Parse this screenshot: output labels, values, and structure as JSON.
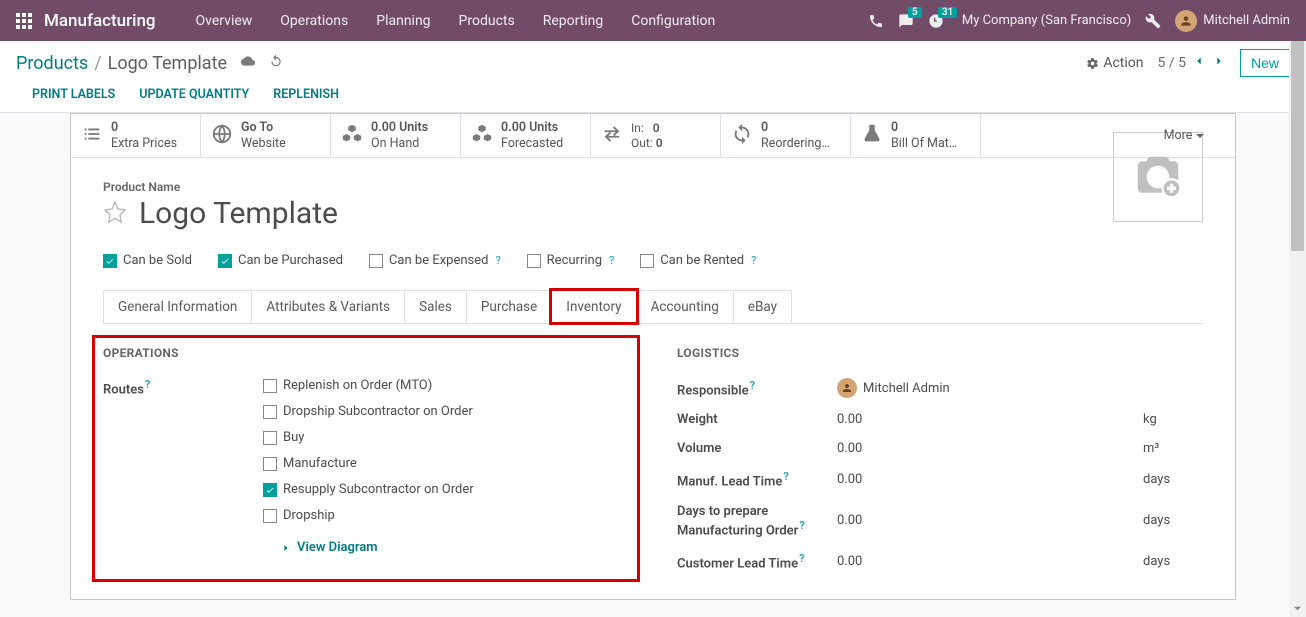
{
  "brand": "Manufacturing",
  "nav": [
    "Overview",
    "Operations",
    "Planning",
    "Products",
    "Reporting",
    "Configuration"
  ],
  "badges": {
    "chat": "5",
    "clock": "31"
  },
  "company": "My Company (San Francisco)",
  "user": "Mitchell Admin",
  "breadcrumb": {
    "root": "Products",
    "current": "Logo Template"
  },
  "action_menu": "Action",
  "pager": "5 / 5",
  "btn_new": "New",
  "action_links": [
    "PRINT LABELS",
    "UPDATE QUANTITY",
    "REPLENISH"
  ],
  "stats": {
    "extra": {
      "v": "0",
      "l": "Extra Prices"
    },
    "goto": {
      "v": "Go To",
      "l": "Website"
    },
    "onhand": {
      "v": "0.00 Units",
      "l": "On Hand"
    },
    "forec": {
      "v": "0.00 Units",
      "l": "Forecasted"
    },
    "inout": {
      "in_l": "In:",
      "in_v": "0",
      "out_l": "Out:",
      "out_v": "0"
    },
    "reord": {
      "v": "0",
      "l": "Reordering…"
    },
    "bom": {
      "v": "0",
      "l": "Bill Of Mat…"
    },
    "more": "More"
  },
  "prod": {
    "name_label": "Product Name",
    "name": "Logo Template"
  },
  "bools": {
    "sold": "Can be Sold",
    "purch": "Can be Purchased",
    "exp": "Can be Expensed",
    "recur": "Recurring",
    "rent": "Can be Rented"
  },
  "tabs": [
    "General Information",
    "Attributes & Variants",
    "Sales",
    "Purchase",
    "Inventory",
    "Accounting",
    "eBay"
  ],
  "ops": {
    "title": "OPERATIONS",
    "routes_label": "Routes",
    "routes": [
      {
        "label": "Replenish on Order (MTO)",
        "checked": false
      },
      {
        "label": "Dropship Subcontractor on Order",
        "checked": false
      },
      {
        "label": "Buy",
        "checked": false
      },
      {
        "label": "Manufacture",
        "checked": false
      },
      {
        "label": "Resupply Subcontractor on Order",
        "checked": true
      },
      {
        "label": "Dropship",
        "checked": false
      }
    ],
    "view_diag": "View Diagram"
  },
  "log": {
    "title": "LOGISTICS",
    "resp_l": "Responsible",
    "resp_v": "Mitchell Admin",
    "weight_l": "Weight",
    "weight_v": "0.00",
    "weight_u": "kg",
    "vol_l": "Volume",
    "vol_v": "0.00",
    "vol_u": "m³",
    "mlt_l": "Manuf. Lead Time",
    "mlt_v": "0.00",
    "mlt_u": "days",
    "dpm_l": "Days to prepare Manufacturing Order",
    "dpm_v": "0.00",
    "dpm_u": "days",
    "clt_l": "Customer Lead Time",
    "clt_v": "0.00",
    "clt_u": "days"
  }
}
